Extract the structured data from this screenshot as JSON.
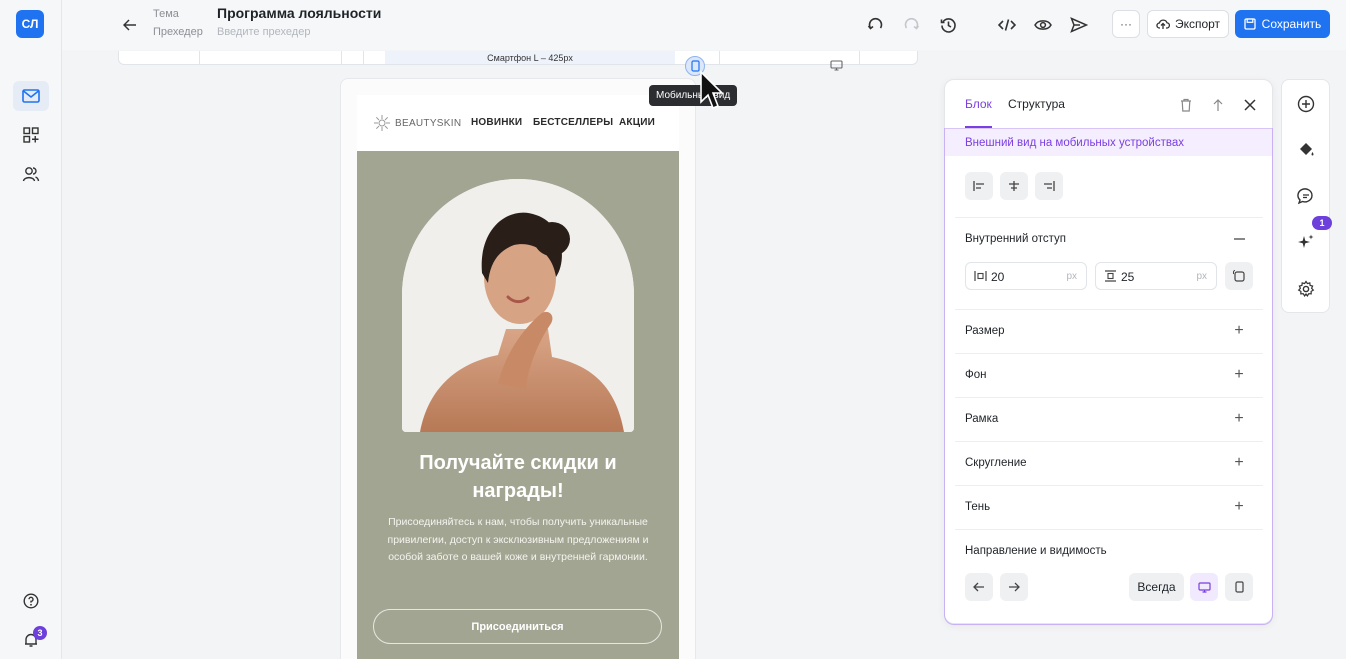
{
  "app": {
    "logo_text": "СЛ",
    "notifications_count": "3"
  },
  "rail": {
    "items": [
      "mail-icon",
      "blocks-icon",
      "users-icon"
    ],
    "bottom": [
      "help-icon",
      "bell-icon"
    ]
  },
  "header": {
    "theme_label": "Тема",
    "title": "Программа лояльности",
    "preheader_label": "Прехедер",
    "preheader_placeholder": "Введите прехедер",
    "more_label": "···",
    "export_label": "Экспорт",
    "save_label": "Сохранить"
  },
  "ruler": {
    "active_label": "Смартфон L – 425px",
    "tooltip": "Мобильный вид"
  },
  "email": {
    "brand": "BEAUTYSKIN",
    "nav": [
      "НОВИНКИ",
      "БЕСТСЕЛЛЕРЫ",
      "АКЦИИ"
    ],
    "hero_title_line1": "Получайте скидки и",
    "hero_title_line2": "награды!",
    "hero_text": "Присоединяйтесь к нам, чтобы получить уникальные привилегии, доступ к эксклюзивным предложениям и особой заботе о вашей коже и внутренней гармонии.",
    "cta_label": "Присоединиться",
    "hero_bg": "#a3a593"
  },
  "panel": {
    "tabs": [
      "Блок",
      "Структура"
    ],
    "banner": "Внешний вид на мобильных устройствах",
    "padding_label": "Внутренний отступ",
    "padding_h": "20",
    "padding_v": "25",
    "unit": "px",
    "rows": [
      "Размер",
      "Фон",
      "Рамка",
      "Скругление",
      "Тень"
    ],
    "direction_label": "Направление и видимость",
    "visibility_value": "Всегда",
    "accent": "#7a3fe0"
  },
  "toolbar": {
    "items": [
      "add-icon",
      "paint-bucket-icon",
      "chat-icon",
      "sparkles-icon",
      "settings-icon"
    ],
    "badge": "1"
  }
}
